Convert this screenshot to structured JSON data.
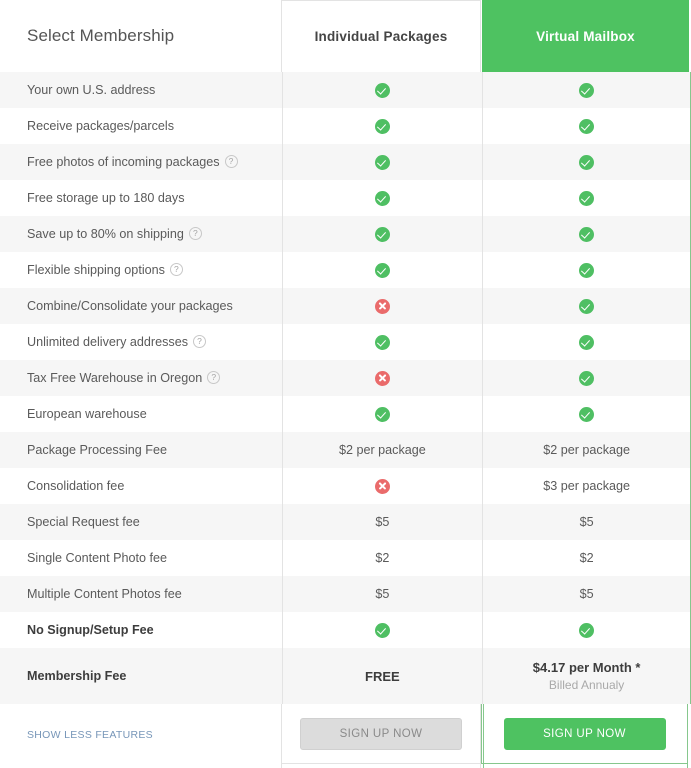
{
  "header": {
    "title": "Select Membership",
    "columns": [
      {
        "label": "Individual Packages",
        "highlight": false
      },
      {
        "label": "Virtual Mailbox",
        "highlight": true
      }
    ]
  },
  "colors": {
    "brand_green": "#4ec261",
    "check_green": "#4fbf63",
    "cross_red": "#ea6b6b",
    "link_blue": "#7796b8",
    "row_stripe": "#f6f6f6",
    "border_grey": "#e3e3e3",
    "border_green": "#86c78d"
  },
  "rows": [
    {
      "label": "Your own U.S. address",
      "help": false,
      "bold": false,
      "individual": {
        "type": "check"
      },
      "virtual": {
        "type": "check"
      }
    },
    {
      "label": "Receive packages/parcels",
      "help": false,
      "bold": false,
      "individual": {
        "type": "check"
      },
      "virtual": {
        "type": "check"
      }
    },
    {
      "label": "Free photos of incoming packages",
      "help": true,
      "bold": false,
      "individual": {
        "type": "check"
      },
      "virtual": {
        "type": "check"
      }
    },
    {
      "label": "Free storage up to 180 days",
      "help": false,
      "bold": false,
      "individual": {
        "type": "check"
      },
      "virtual": {
        "type": "check"
      }
    },
    {
      "label": "Save up to 80% on shipping",
      "help": true,
      "bold": false,
      "individual": {
        "type": "check"
      },
      "virtual": {
        "type": "check"
      }
    },
    {
      "label": "Flexible shipping options",
      "help": true,
      "bold": false,
      "individual": {
        "type": "check"
      },
      "virtual": {
        "type": "check"
      }
    },
    {
      "label": "Combine/Consolidate your packages",
      "help": false,
      "bold": false,
      "individual": {
        "type": "cross"
      },
      "virtual": {
        "type": "check"
      }
    },
    {
      "label": "Unlimited delivery addresses",
      "help": true,
      "bold": false,
      "individual": {
        "type": "check"
      },
      "virtual": {
        "type": "check"
      }
    },
    {
      "label": "Tax Free Warehouse in Oregon",
      "help": true,
      "bold": false,
      "individual": {
        "type": "cross"
      },
      "virtual": {
        "type": "check"
      }
    },
    {
      "label": "European warehouse",
      "help": false,
      "bold": false,
      "individual": {
        "type": "check"
      },
      "virtual": {
        "type": "check"
      }
    },
    {
      "label": "Package Processing Fee",
      "help": false,
      "bold": false,
      "individual": {
        "type": "text",
        "text": "$2 per package"
      },
      "virtual": {
        "type": "text",
        "text": "$2 per package"
      }
    },
    {
      "label": "Consolidation fee",
      "help": false,
      "bold": false,
      "individual": {
        "type": "cross"
      },
      "virtual": {
        "type": "text",
        "text": "$3 per package"
      }
    },
    {
      "label": "Special Request fee",
      "help": false,
      "bold": false,
      "individual": {
        "type": "text",
        "text": "$5"
      },
      "virtual": {
        "type": "text",
        "text": "$5"
      }
    },
    {
      "label": "Single Content Photo fee",
      "help": false,
      "bold": false,
      "individual": {
        "type": "text",
        "text": "$2"
      },
      "virtual": {
        "type": "text",
        "text": "$2"
      }
    },
    {
      "label": "Multiple Content Photos fee",
      "help": false,
      "bold": false,
      "individual": {
        "type": "text",
        "text": "$5"
      },
      "virtual": {
        "type": "text",
        "text": "$5"
      }
    },
    {
      "label": "No Signup/Setup Fee",
      "help": false,
      "bold": true,
      "individual": {
        "type": "check"
      },
      "virtual": {
        "type": "check"
      }
    },
    {
      "label": "Membership Fee",
      "help": false,
      "bold": true,
      "tall": true,
      "individual": {
        "type": "text",
        "text": "FREE",
        "bold": true
      },
      "virtual": {
        "type": "price",
        "main": "$4.17 per Month *",
        "sub": "Billed Annualy"
      }
    }
  ],
  "footer": {
    "show_less_label": "SHOW LESS FEATURES",
    "individual_cta": "SIGN UP NOW",
    "virtual_cta": "SIGN UP NOW"
  },
  "icons": {
    "help_glyph": "?",
    "check_name": "check-circle-icon",
    "cross_name": "cross-circle-icon"
  }
}
